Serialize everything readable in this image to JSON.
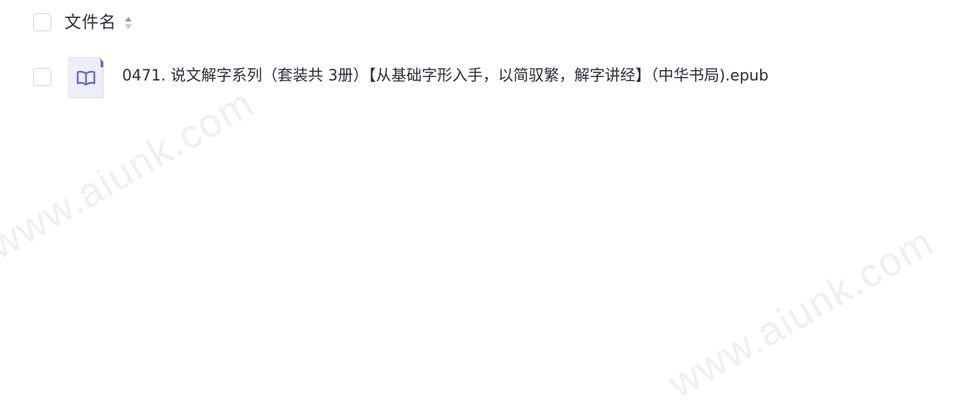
{
  "header": {
    "column_title": "文件名",
    "sort_icon": "sort-caret-icon"
  },
  "files": [
    {
      "name": "0471. 说文解字系列（套装共 3册）【从基础字形入手，以简驭繁，解字讲经】（中华书局).epub",
      "icon": "ebook-file-icon"
    }
  ],
  "watermark": {
    "text": "www.aiunk.com"
  },
  "colors": {
    "text": "#2b2f3a",
    "checkbox_border": "#cfd2da",
    "icon_accent": "#6c68d6",
    "icon_background": "#eeeef9"
  }
}
